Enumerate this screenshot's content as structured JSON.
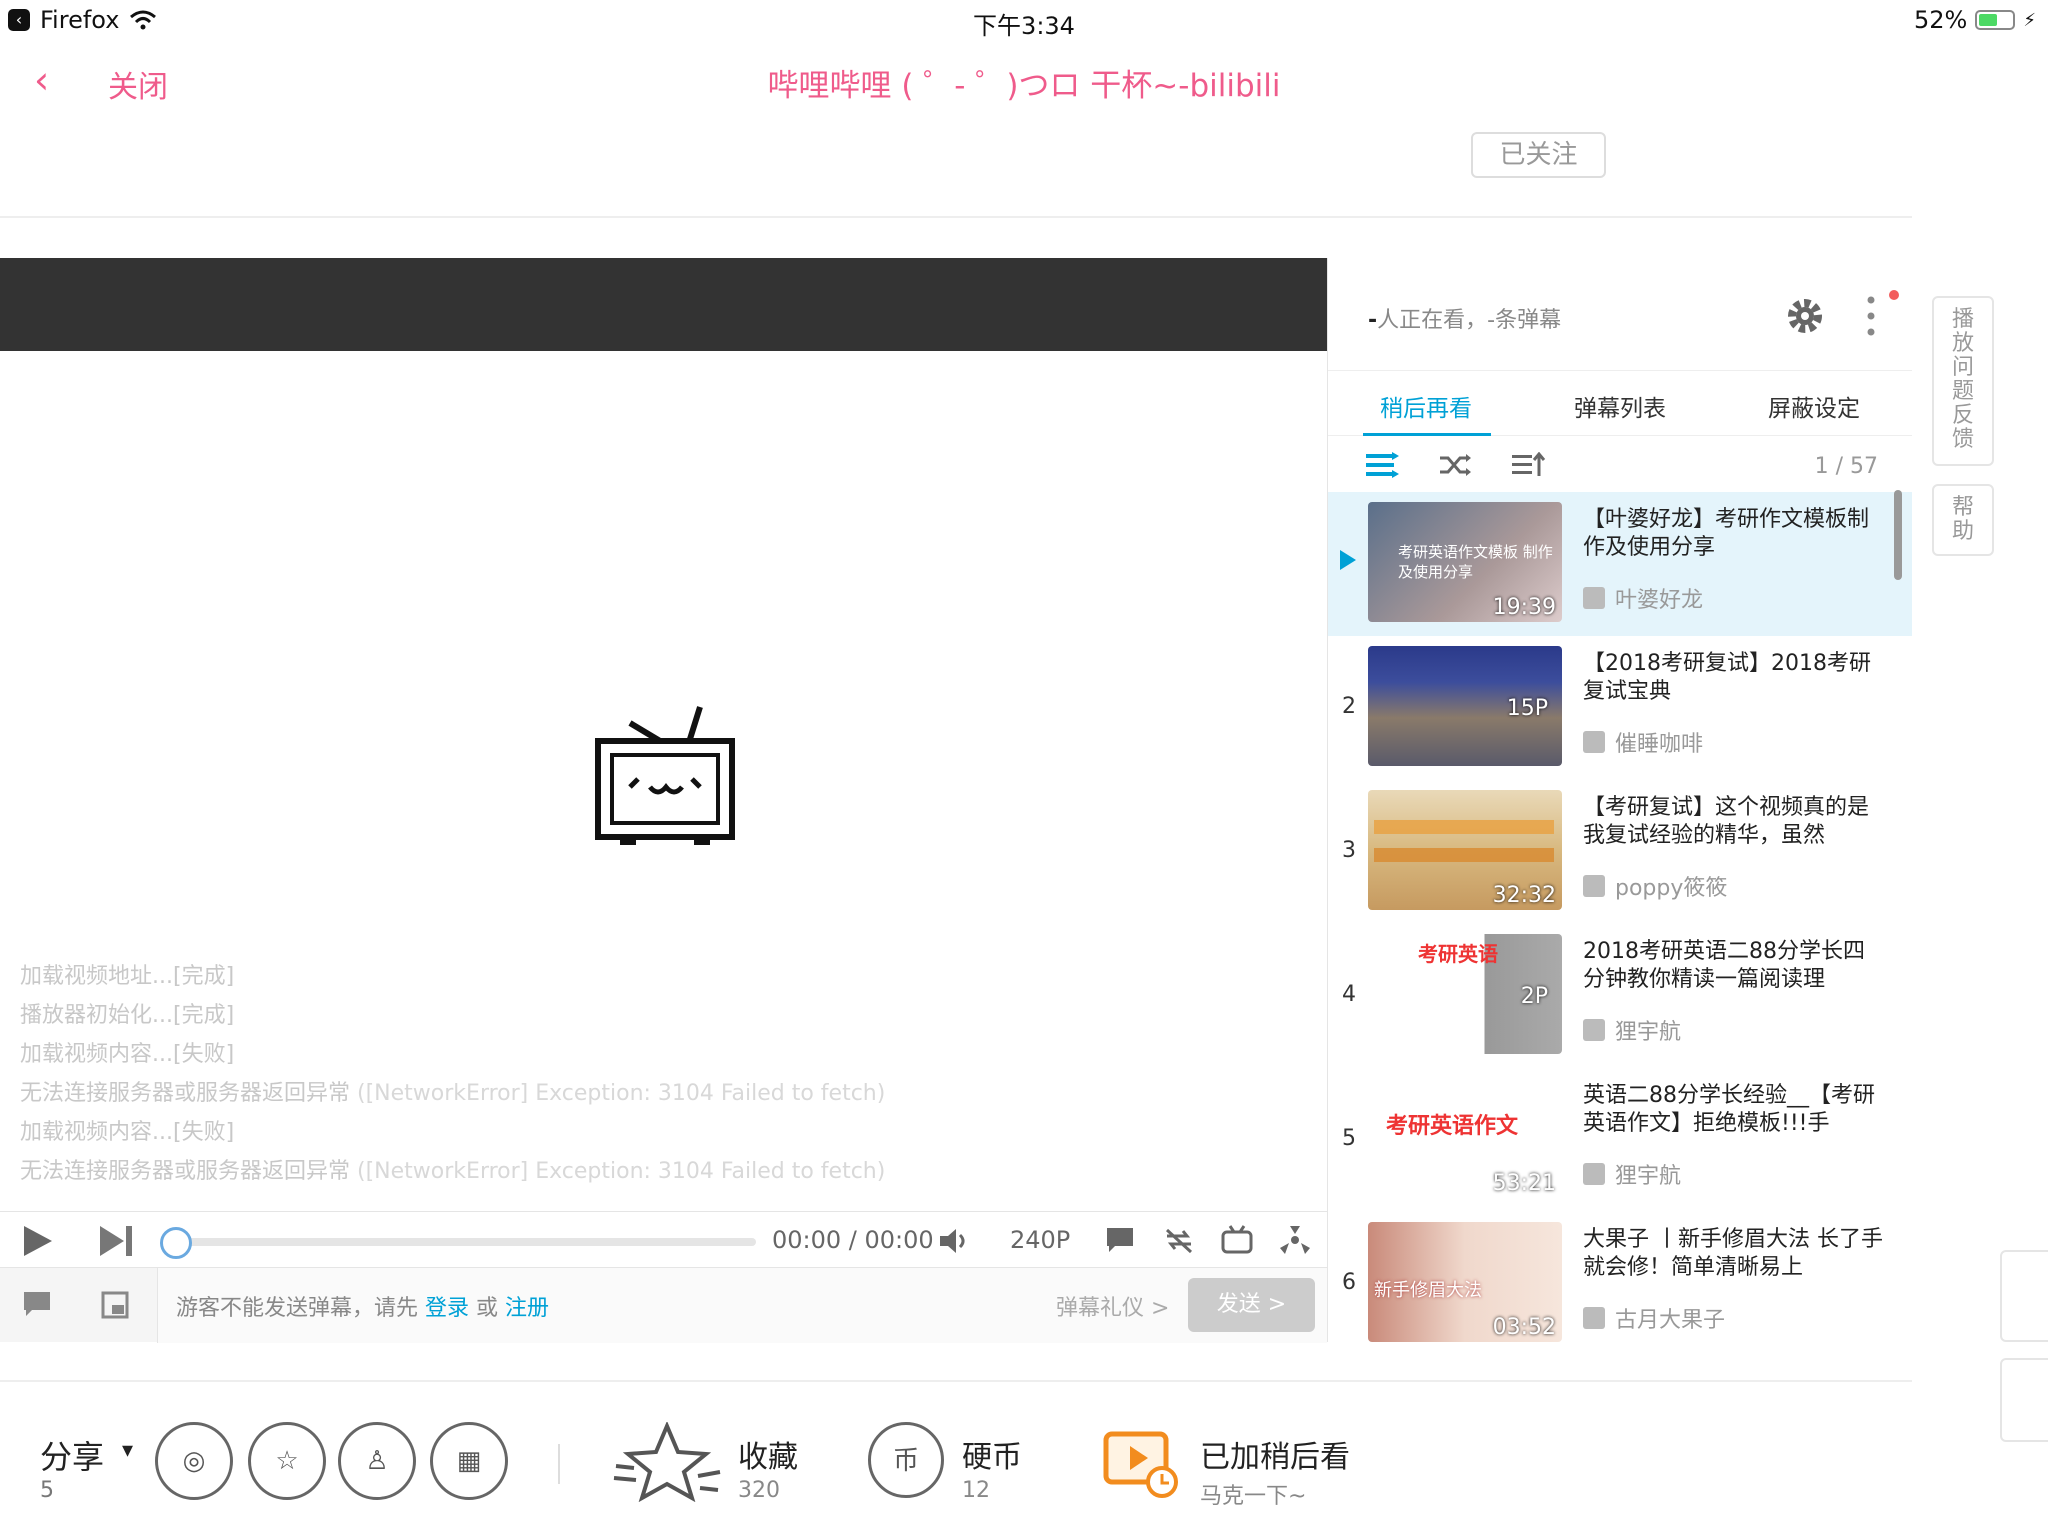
{
  "status": {
    "app": "Firefox",
    "time": "下午3:34",
    "battery": "52%"
  },
  "nav": {
    "close": "关闭",
    "title": "哔哩哔哩 ( ゜- ゜)つロ 干杯~-bilibili"
  },
  "follow_button": "已关注",
  "logs": [
    "加载视频地址...[完成]",
    "播放器初始化...[完成]",
    "加载视频内容...[失败]",
    "无法连接服务器或服务器返回异常",
    "([NetworkError] Exception: 3104 Failed to fetch)",
    "加载视频内容...[失败]",
    "无法连接服务器或服务器返回异常",
    "([NetworkError] Exception: 3104 Failed to fetch)"
  ],
  "controls": {
    "time": "00:00  /  00:00",
    "quality": "240P",
    "progress": 0
  },
  "danmaku": {
    "prompt": "游客不能发送弹幕，请先",
    "login": "登录",
    "or": "或",
    "register": "注册",
    "etiquette": "弹幕礼仪 >",
    "send": "发送 >"
  },
  "panel": {
    "viewers_dash": "-",
    "viewers_text": "人正在看，-条弹幕",
    "tabs": [
      "稍后再看",
      "弹幕列表",
      "屏蔽设定"
    ],
    "page_count": "1 / 57",
    "items": [
      {
        "title": "【叶婆好龙】考研作文模板制作及使用分享",
        "uploader": "叶婆好龙",
        "duration": "19:39",
        "thumb_text": "考研英语作文模板 制作及使用分享"
      },
      {
        "idx": "2",
        "title": "【2018考研复试】2018考研复试宝典",
        "uploader": "催睡咖啡",
        "duration": "15P"
      },
      {
        "idx": "3",
        "title": "【考研复试】这个视频真的是我复试经验的精华，虽然",
        "uploader": "poppy筱筱",
        "duration": "32:32"
      },
      {
        "idx": "4",
        "title": "2018考研英语二88分学长四分钟教你精读一篇阅读理",
        "uploader": "狸宇航",
        "duration": "2P",
        "thumb_text": "考研英语"
      },
      {
        "idx": "5",
        "title": "英语二88分学长经验__【考研英语作文】拒绝模板!!!手",
        "uploader": "狸宇航",
        "duration": "53:21",
        "thumb_text": "考研英语作文"
      },
      {
        "idx": "6",
        "title": "大果子 丨新手修眉大法 长了手就会修！简单清晰易上",
        "uploader": "古月大果子",
        "duration": "03:52",
        "thumb_text": "新手修眉大法"
      }
    ]
  },
  "side": {
    "feedback": "播放问题反馈",
    "help": "帮助"
  },
  "bottom": {
    "share": "分享",
    "share_count": "5",
    "favorite": "收藏",
    "favorite_count": "320",
    "coin": "硬币",
    "coin_count": "12",
    "watch_later": "已加稍后看",
    "watch_later_sub": "马克一下~"
  }
}
